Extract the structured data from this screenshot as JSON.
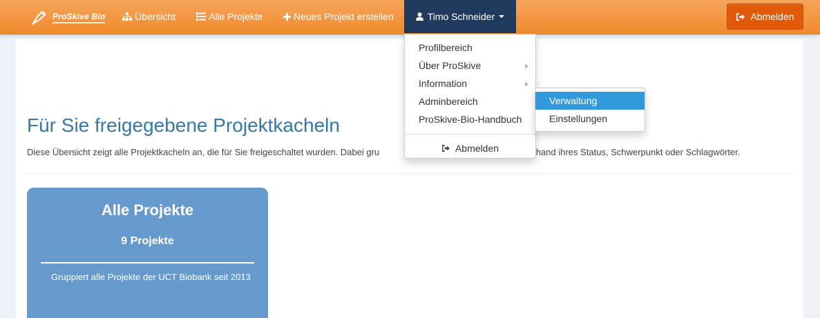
{
  "brand": {
    "name": "ProSkive Bio",
    "icon": "pen-nib-logo-icon"
  },
  "nav": {
    "items": [
      {
        "label": "Übersicht",
        "icon": "sitemap-icon"
      },
      {
        "label": "Alle Projekte",
        "icon": "list-icon"
      },
      {
        "label": "Neues Projekt erstellen",
        "icon": "plus-icon"
      }
    ],
    "user": {
      "label": "Timo Schneider",
      "icon": "user-icon"
    },
    "logout_label": "Abmelden"
  },
  "user_menu": {
    "items": [
      {
        "label": "Profilbereich"
      },
      {
        "label": "Über ProSkive",
        "has_submenu": true
      },
      {
        "label": "Information",
        "has_submenu": true
      },
      {
        "label": "Adminbereich"
      },
      {
        "label": "ProSkive-Bio-Handbuch"
      }
    ],
    "logout_label": "Abmelden"
  },
  "submenu": {
    "items": [
      {
        "label": "Verwaltung",
        "active": true
      },
      {
        "label": "Einstellungen"
      }
    ]
  },
  "page": {
    "title": "Für Sie freigegebene Projektkacheln",
    "description_left": "Diese Übersicht zeigt alle Projektkacheln an, die für Sie freigeschaltet wurden. Dabei gru",
    "description_right": "ekte anhand ihres Status, Schwerpunkt oder Schlagwörter."
  },
  "tiles": [
    {
      "title": "Alle Projekte",
      "count": "9 Projekte",
      "description": "Gruppiert alle Projekte der UCT Biobank seit 2013"
    }
  ],
  "colors": {
    "navbar_orange": "#f08a2c",
    "user_menu_navy": "#1f3a5c",
    "logout_button": "#e05a0a",
    "title_blue": "#3478a8",
    "tile_blue": "#6699cc",
    "submenu_active": "#3399dd"
  }
}
